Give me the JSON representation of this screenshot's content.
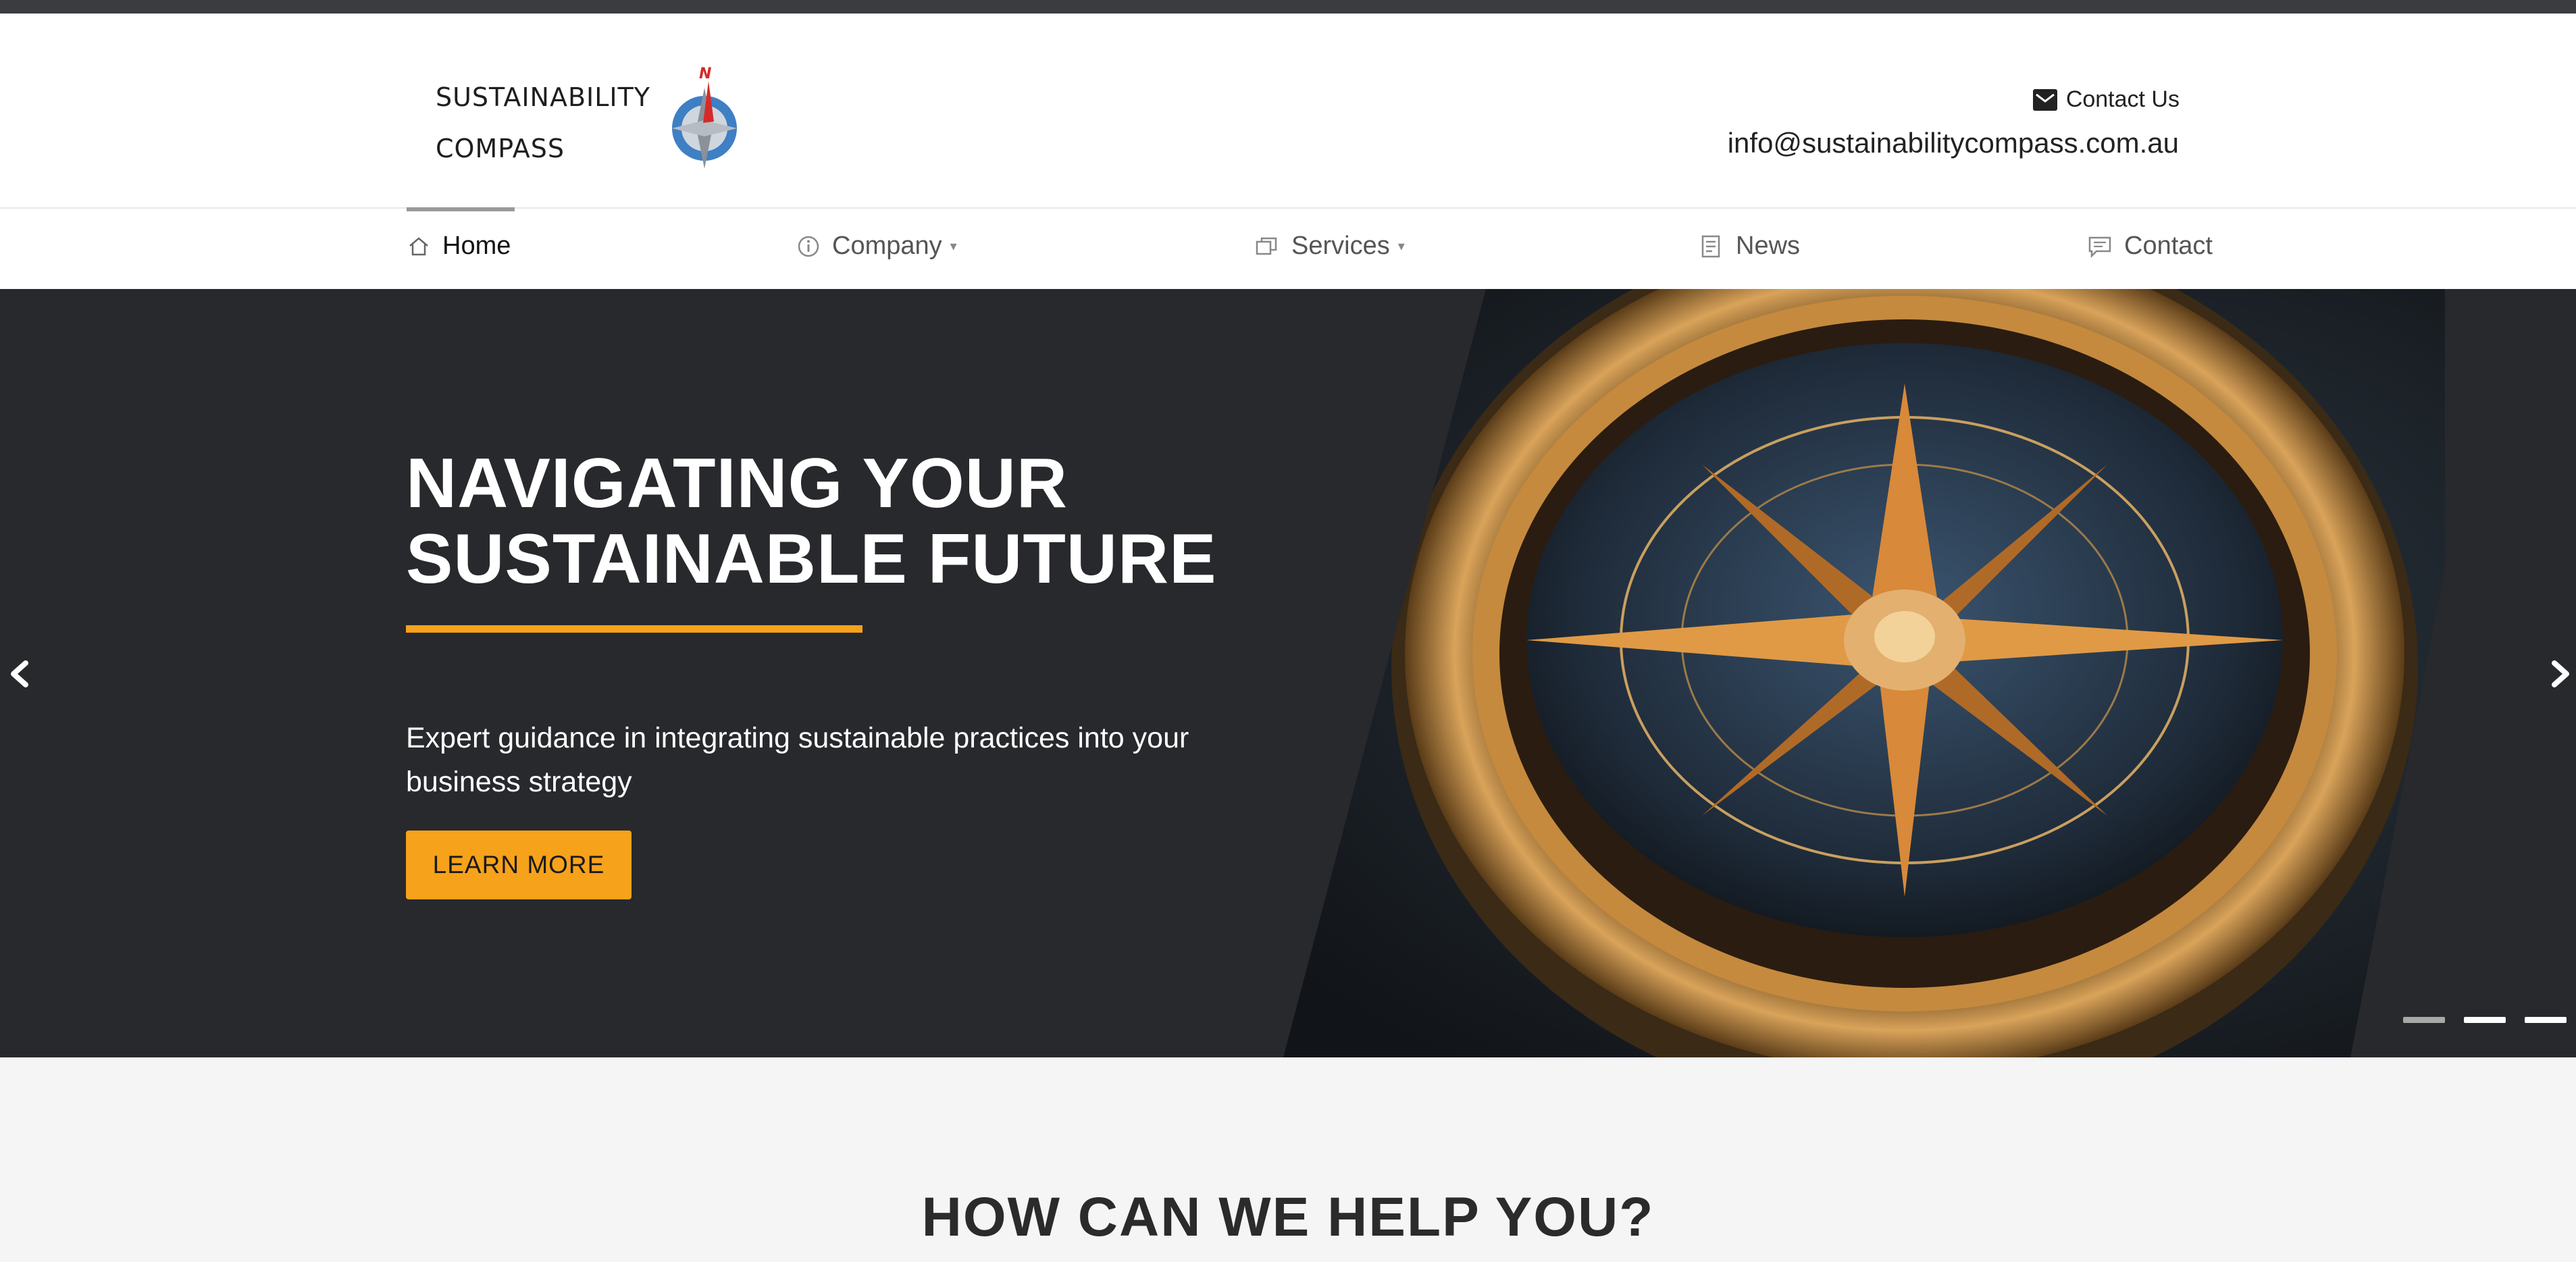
{
  "header": {
    "logo": {
      "line1": "SUSTAINABILITY",
      "line2": "COMPASS",
      "icon": "compass-logo-icon"
    },
    "contact_us_label": "Contact Us",
    "contact_icon": "envelope-icon",
    "email": "info@sustainabilitycompass.com.au"
  },
  "nav": {
    "items": [
      {
        "label": "Home",
        "icon": "home-icon",
        "active": true
      },
      {
        "label": "Company",
        "icon": "info-icon",
        "dropdown": true
      },
      {
        "label": "Services",
        "icon": "services-icon",
        "dropdown": true
      },
      {
        "label": "News",
        "icon": "news-icon"
      },
      {
        "label": "Contact",
        "icon": "chat-icon"
      }
    ],
    "caret": "▾"
  },
  "hero": {
    "title_line1": "NAVIGATING YOUR",
    "title_line2": "SUSTAINABLE FUTURE",
    "text": "Expert guidance in integrating sustainable practices into your business strategy",
    "button_label": "LEARN MORE",
    "image": "compass-photo",
    "slides_count": 3,
    "current_slide": 1
  },
  "colors": {
    "accent": "#f7a21b",
    "hero_bg": "#28292d",
    "topbar": "#3b3c40",
    "section_bg": "#f5f5f5"
  },
  "section": {
    "title": "HOW CAN WE HELP YOU?"
  }
}
